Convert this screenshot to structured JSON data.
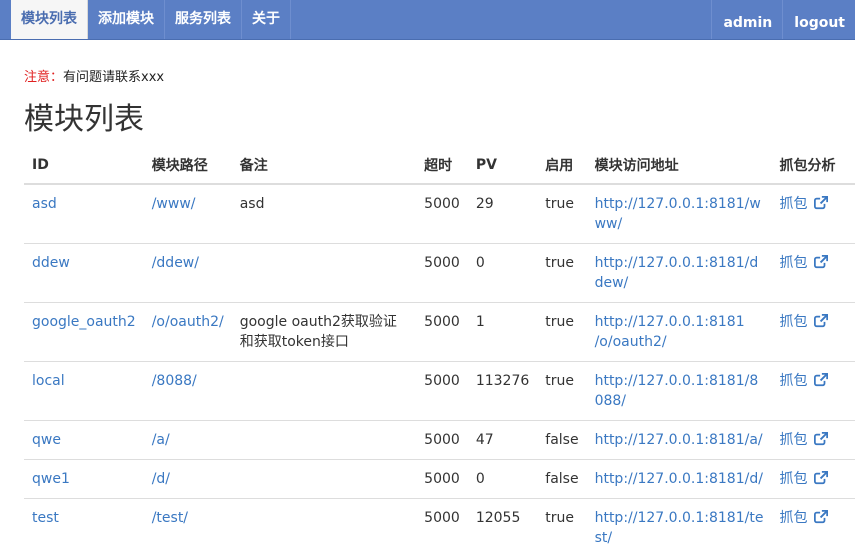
{
  "nav": {
    "tabs": [
      "模块列表",
      "添加模块",
      "服务列表",
      "关于"
    ],
    "user": "admin",
    "logout": "logout"
  },
  "notice": {
    "label": "注意：",
    "text": "有问题请联系xxx"
  },
  "page_title": "模块列表",
  "table": {
    "headers": [
      "ID",
      "模块路径",
      "备注",
      "超时",
      "PV",
      "启用",
      "模块访问地址",
      "抓包分析"
    ],
    "rows": [
      {
        "id": "asd",
        "path": "/www/",
        "note": "asd",
        "timeout": "5000",
        "pv": "29",
        "enabled": "true",
        "url": "http://127.0.0.1:8181/www/",
        "capture": "抓包"
      },
      {
        "id": "ddew",
        "path": "/ddew/",
        "note": "",
        "timeout": "5000",
        "pv": "0",
        "enabled": "true",
        "url": "http://127.0.0.1:8181/ddew/",
        "capture": "抓包"
      },
      {
        "id": "google_oauth2",
        "path": "/o/oauth2/",
        "note": "google oauth2获取验证和获取token接口",
        "timeout": "5000",
        "pv": "1",
        "enabled": "true",
        "url": "http://127.0.0.1:8181/o/oauth2/",
        "capture": "抓包"
      },
      {
        "id": "local",
        "path": "/8088/",
        "note": "",
        "timeout": "5000",
        "pv": "113276",
        "enabled": "true",
        "url": "http://127.0.0.1:8181/8088/",
        "capture": "抓包"
      },
      {
        "id": "qwe",
        "path": "/a/",
        "note": "",
        "timeout": "5000",
        "pv": "47",
        "enabled": "false",
        "url": "http://127.0.0.1:8181/a/",
        "capture": "抓包"
      },
      {
        "id": "qwe1",
        "path": "/d/",
        "note": "",
        "timeout": "5000",
        "pv": "0",
        "enabled": "false",
        "url": "http://127.0.0.1:8181/d/",
        "capture": "抓包"
      },
      {
        "id": "test",
        "path": "/test/",
        "note": "",
        "timeout": "5000",
        "pv": "12055",
        "enabled": "true",
        "url": "http://127.0.0.1:8181/test/",
        "capture": "抓包"
      }
    ]
  },
  "colors": {
    "navbar": "#5b7fc5",
    "link": "#3a78c2",
    "false": "#e02020",
    "notice_label": "#e02020"
  },
  "icons": {
    "capture_link": "external-link-icon"
  }
}
